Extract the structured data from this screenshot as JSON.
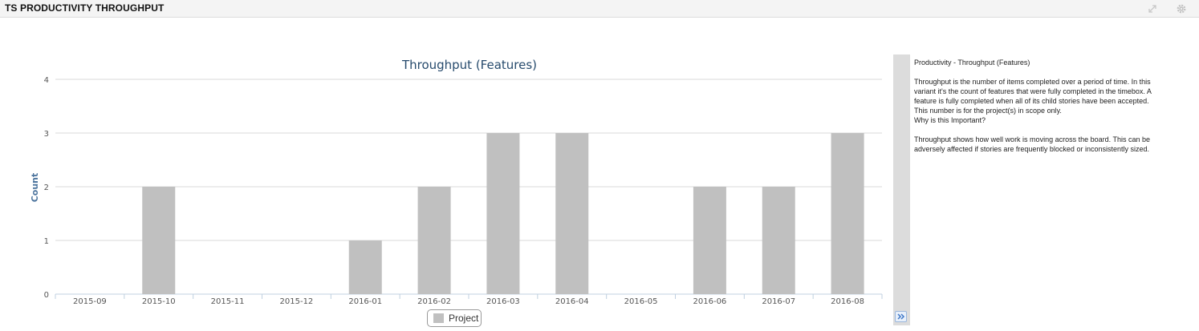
{
  "panel": {
    "title": "TS PRODUCTIVITY THROUGHPUT",
    "icons": {
      "expand": "expand-icon",
      "settings": "gear-icon"
    }
  },
  "chart_data": {
    "type": "bar",
    "title": "Throughput (Features)",
    "xlabel": "",
    "ylabel": "Count",
    "ylim": [
      0,
      4
    ],
    "yticks": [
      0,
      1,
      2,
      3,
      4
    ],
    "grid": true,
    "legend_position": "bottom-center",
    "categories": [
      "2015-09",
      "2015-10",
      "2015-11",
      "2015-12",
      "2016-01",
      "2016-02",
      "2016-03",
      "2016-04",
      "2016-05",
      "2016-06",
      "2016-07",
      "2016-08"
    ],
    "series": [
      {
        "name": "Project",
        "color": "#c0c0c0",
        "values": [
          0,
          2,
          0,
          0,
          1,
          2,
          3,
          3,
          0,
          2,
          2,
          3
        ]
      }
    ]
  },
  "colors": {
    "bar": "#c0c0c0",
    "title": "#274b6d",
    "axis_title": "#4d759e",
    "grid": "#d8d8d8",
    "tick_label": "#555555"
  },
  "description": {
    "title": "Productivity - Throughput (Features)",
    "paragraphs": [
      "Throughput is the number of items completed over a period of time. In this variant it's the count of features that were fully completed in the timebox. A feature is fully completed when all of its child stories have been accepted.",
      "This number is for the project(s) in scope only.",
      "Why is this Important?"
    ],
    "paragraph2": "Throughput shows how well work is moving across the board. This can be adversely affected if stories are frequently blocked or inconsistently sized."
  },
  "collapse_button": {
    "icon": "double-chevron-right-icon",
    "glyph": "»"
  }
}
